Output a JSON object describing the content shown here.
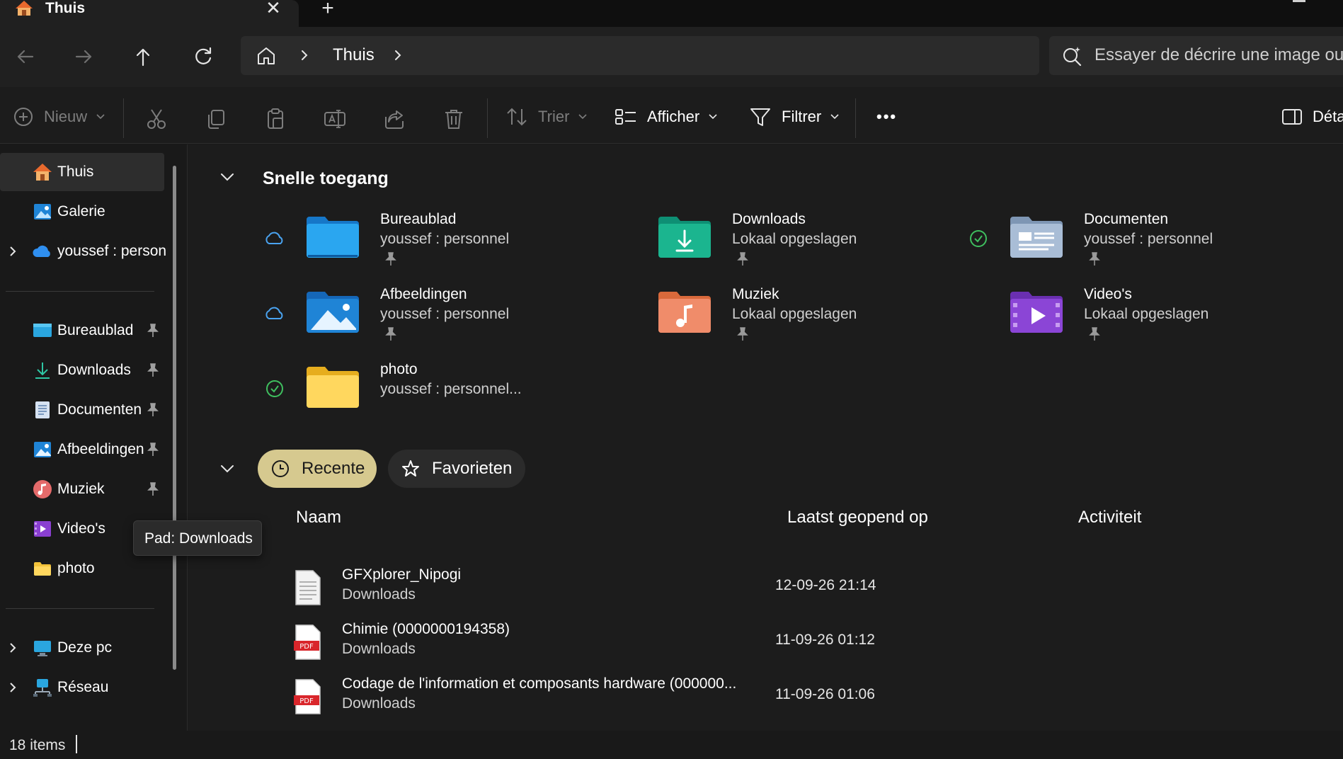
{
  "window": {
    "tab_title": "Thuis",
    "tab_close_glyph": "✕",
    "new_tab_glyph": "+"
  },
  "navigation": {
    "back": "arrow-left-icon",
    "forward": "arrow-right-icon",
    "up": "arrow-up-icon",
    "refresh": "refresh-icon",
    "breadcrumb": [
      "Thuis"
    ]
  },
  "search": {
    "placeholder": "Essayer de décrire une image ou"
  },
  "toolbar": {
    "new_label": "Nieuw",
    "sort_label": "Trier",
    "view_label": "Afficher",
    "filter_label": "Filtrer",
    "more_glyph": "•••",
    "details_label": "Déta"
  },
  "sidebar": {
    "top_items": [
      {
        "label": "Thuis",
        "icon": "home-icon",
        "selected": true
      },
      {
        "label": "Galerie",
        "icon": "gallery-icon"
      },
      {
        "label": "youssef : person",
        "icon": "onedrive-icon",
        "expandable": true
      }
    ],
    "pinned_items": [
      {
        "label": "Bureaublad",
        "icon": "desktop-icon",
        "pinned": true
      },
      {
        "label": "Downloads",
        "icon": "download-icon",
        "pinned": true
      },
      {
        "label": "Documenten",
        "icon": "documents-icon",
        "pinned": true
      },
      {
        "label": "Afbeeldingen",
        "icon": "pictures-icon",
        "pinned": true
      },
      {
        "label": "Muziek",
        "icon": "music-icon",
        "pinned": true
      },
      {
        "label": "Video's",
        "icon": "video-icon"
      },
      {
        "label": "photo",
        "icon": "folder-icon"
      }
    ],
    "bottom_items": [
      {
        "label": "Deze pc",
        "icon": "pc-icon",
        "expandable": true
      },
      {
        "label": "Réseau",
        "icon": "network-icon",
        "expandable": true
      }
    ]
  },
  "quick_access": {
    "title": "Snelle toegang",
    "items": [
      {
        "name": "Bureaublad",
        "sub": "youssef : personnel",
        "status": "cloud",
        "pinned": true,
        "folder": "desktop"
      },
      {
        "name": "Downloads",
        "sub": "Lokaal opgeslagen",
        "status": "none",
        "pinned": true,
        "folder": "downloads"
      },
      {
        "name": "Documenten",
        "sub": "youssef : personnel",
        "status": "synced",
        "pinned": true,
        "folder": "documents"
      },
      {
        "name": "Afbeeldingen",
        "sub": "youssef : personnel",
        "status": "cloud",
        "pinned": true,
        "folder": "pictures"
      },
      {
        "name": "Muziek",
        "sub": "Lokaal opgeslagen",
        "status": "none",
        "pinned": true,
        "folder": "music"
      },
      {
        "name": "Video's",
        "sub": "Lokaal opgeslagen",
        "status": "none",
        "pinned": true,
        "folder": "videos"
      },
      {
        "name": "photo",
        "sub": "youssef : personnel...",
        "status": "synced",
        "pinned": false,
        "folder": "photo"
      }
    ]
  },
  "recent": {
    "tabs": [
      {
        "label": "Recente",
        "active": true
      },
      {
        "label": "Favorieten",
        "active": false
      }
    ],
    "columns": [
      "Naam",
      "Laatst geopend op",
      "Activiteit"
    ],
    "files": [
      {
        "name": "GFXplorer_Nipogi",
        "location": "Downloads",
        "opened": "12-09-26 21:14",
        "type": "text"
      },
      {
        "name": "Chimie (0000000194358)",
        "location": "Downloads",
        "opened": "11-09-26 01:12",
        "type": "pdf"
      },
      {
        "name": "Codage de l'information et composants hardware (000000...",
        "location": "Downloads",
        "opened": "11-09-26 01:06",
        "type": "pdf"
      }
    ]
  },
  "tooltip": {
    "text": "Pad: Downloads"
  },
  "status_bar": {
    "item_count": "18 items"
  },
  "colors": {
    "accent_pill": "#d6c98f",
    "cloud_blue": "#4aa3f0",
    "synced_green": "#3fbf5f",
    "pdf_red": "#d9262b"
  }
}
